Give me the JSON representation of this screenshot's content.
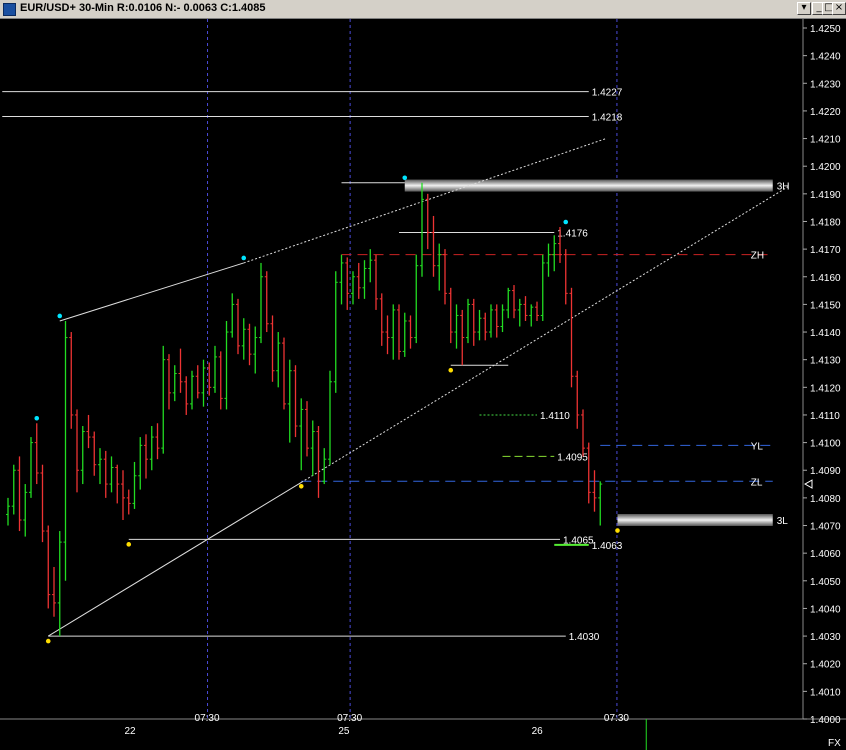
{
  "window": {
    "title": "EUR/USD+ 30-Min R:0.0106 N:- 0.0063 C:1.4085",
    "buttons": {
      "menu": "▾",
      "minimize": "_",
      "maximize": "□",
      "close": "×"
    }
  },
  "colors": {
    "background": "#000000",
    "up_bar": "#22dd22",
    "down_bar": "#ee3333",
    "axis_text": "#dddddd",
    "session_line": "#4a4ad8",
    "zone_bar": "#cccccc"
  },
  "chart_data": {
    "type": "ohlc",
    "symbol": "EUR/USD+",
    "interval": "30-Min",
    "y_axis": {
      "min": 1.4,
      "max": 1.425,
      "step": 0.001,
      "decimals": 4,
      "side": "right"
    },
    "x_axis": {
      "day_labels": [
        "22",
        "25",
        "26"
      ],
      "session_labels": [
        "07:30",
        "07:30",
        "07:30"
      ]
    },
    "footer_label": "FX",
    "bars": [
      [
        1.4074,
        1.408,
        1.407,
        1.4077
      ],
      [
        1.4077,
        1.4092,
        1.4074,
        1.409
      ],
      [
        1.409,
        1.4095,
        1.4068,
        1.4072
      ],
      [
        1.4072,
        1.4085,
        1.4066,
        1.4082
      ],
      [
        1.4082,
        1.4102,
        1.408,
        1.41
      ],
      [
        1.41,
        1.4107,
        1.4085,
        1.4089
      ],
      [
        1.4089,
        1.4092,
        1.4064,
        1.4068
      ],
      [
        1.4068,
        1.407,
        1.404,
        1.4045
      ],
      [
        1.4045,
        1.4055,
        1.4037,
        1.4042
      ],
      [
        1.4042,
        1.4068,
        1.403,
        1.4064
      ],
      [
        1.4064,
        1.4144,
        1.405,
        1.4138
      ],
      [
        1.4138,
        1.414,
        1.4105,
        1.411
      ],
      [
        1.411,
        1.4112,
        1.4082,
        1.409
      ],
      [
        1.409,
        1.4106,
        1.4085,
        1.4104
      ],
      [
        1.4104,
        1.411,
        1.4098,
        1.4102
      ],
      [
        1.4102,
        1.4104,
        1.4088,
        1.4092
      ],
      [
        1.4092,
        1.4098,
        1.4085,
        1.4094
      ],
      [
        1.4094,
        1.4097,
        1.408,
        1.4085
      ],
      [
        1.4085,
        1.4095,
        1.4082,
        1.4091
      ],
      [
        1.4091,
        1.4092,
        1.4078,
        1.4085
      ],
      [
        1.4085,
        1.409,
        1.4072,
        1.408
      ],
      [
        1.408,
        1.4083,
        1.4074,
        1.4078
      ],
      [
        1.4078,
        1.4093,
        1.4076,
        1.4088
      ],
      [
        1.4088,
        1.4102,
        1.4083,
        1.4099
      ],
      [
        1.4099,
        1.4103,
        1.4087,
        1.4094
      ],
      [
        1.4094,
        1.4106,
        1.409,
        1.4102
      ],
      [
        1.4102,
        1.4107,
        1.4094,
        1.4098
      ],
      [
        1.4098,
        1.4135,
        1.4096,
        1.413
      ],
      [
        1.413,
        1.4132,
        1.4112,
        1.4118
      ],
      [
        1.4118,
        1.4128,
        1.4115,
        1.4125
      ],
      [
        1.4125,
        1.4134,
        1.4118,
        1.4122
      ],
      [
        1.4122,
        1.4124,
        1.411,
        1.4114
      ],
      [
        1.4114,
        1.4126,
        1.4112,
        1.4124
      ],
      [
        1.4124,
        1.4128,
        1.4116,
        1.4118
      ],
      [
        1.4118,
        1.413,
        1.4113,
        1.4127
      ],
      [
        1.4127,
        1.4129,
        1.4117,
        1.412
      ],
      [
        1.412,
        1.4135,
        1.4118,
        1.4131
      ],
      [
        1.4131,
        1.4133,
        1.4112,
        1.4116
      ],
      [
        1.4116,
        1.4144,
        1.4112,
        1.414
      ],
      [
        1.414,
        1.4154,
        1.4138,
        1.415
      ],
      [
        1.415,
        1.4152,
        1.4132,
        1.4135
      ],
      [
        1.4135,
        1.4145,
        1.413,
        1.4141
      ],
      [
        1.4141,
        1.4143,
        1.4128,
        1.4132
      ],
      [
        1.4132,
        1.4142,
        1.4125,
        1.4138
      ],
      [
        1.4138,
        1.4165,
        1.4136,
        1.416
      ],
      [
        1.416,
        1.4162,
        1.414,
        1.4143
      ],
      [
        1.4143,
        1.4146,
        1.4122,
        1.4126
      ],
      [
        1.4126,
        1.414,
        1.412,
        1.4136
      ],
      [
        1.4136,
        1.4138,
        1.4112,
        1.4114
      ],
      [
        1.4114,
        1.413,
        1.41,
        1.4126
      ],
      [
        1.4126,
        1.4128,
        1.4102,
        1.4106
      ],
      [
        1.4106,
        1.4116,
        1.409,
        1.4112
      ],
      [
        1.4112,
        1.4115,
        1.4095,
        1.4098
      ],
      [
        1.4098,
        1.4108,
        1.4088,
        1.4104
      ],
      [
        1.4104,
        1.4106,
        1.408,
        1.4086
      ],
      [
        1.4086,
        1.4098,
        1.4085,
        1.4094
      ],
      [
        1.4094,
        1.4126,
        1.4092,
        1.4122
      ],
      [
        1.4122,
        1.4162,
        1.4118,
        1.4158
      ],
      [
        1.4158,
        1.4168,
        1.415,
        1.4165
      ],
      [
        1.4165,
        1.4167,
        1.4148,
        1.4154
      ],
      [
        1.4154,
        1.4162,
        1.415,
        1.416
      ],
      [
        1.416,
        1.4165,
        1.4152,
        1.4156
      ],
      [
        1.4156,
        1.4166,
        1.4152,
        1.4163
      ],
      [
        1.4163,
        1.417,
        1.4158,
        1.4166
      ],
      [
        1.4166,
        1.4168,
        1.4148,
        1.4152
      ],
      [
        1.4152,
        1.4154,
        1.4135,
        1.414
      ],
      [
        1.414,
        1.4146,
        1.4132,
        1.4138
      ],
      [
        1.4138,
        1.415,
        1.413,
        1.4148
      ],
      [
        1.4148,
        1.415,
        1.413,
        1.4133
      ],
      [
        1.4133,
        1.4147,
        1.4131,
        1.4144
      ],
      [
        1.4144,
        1.4146,
        1.4134,
        1.4138
      ],
      [
        1.4138,
        1.4168,
        1.4136,
        1.4164
      ],
      [
        1.4164,
        1.4194,
        1.416,
        1.4188
      ],
      [
        1.4188,
        1.419,
        1.417,
        1.4176
      ],
      [
        1.4176,
        1.4182,
        1.416,
        1.4164
      ],
      [
        1.4164,
        1.4172,
        1.4155,
        1.4168
      ],
      [
        1.4168,
        1.417,
        1.415,
        1.4154
      ],
      [
        1.4154,
        1.4156,
        1.4136,
        1.414
      ],
      [
        1.414,
        1.415,
        1.4134,
        1.4146
      ],
      [
        1.4146,
        1.4148,
        1.4128,
        1.4138
      ],
      [
        1.4138,
        1.4152,
        1.4136,
        1.415
      ],
      [
        1.415,
        1.4152,
        1.4135,
        1.414
      ],
      [
        1.414,
        1.4148,
        1.4137,
        1.4145
      ],
      [
        1.4145,
        1.4147,
        1.4137,
        1.414
      ],
      [
        1.414,
        1.415,
        1.4138,
        1.4148
      ],
      [
        1.4148,
        1.415,
        1.4138,
        1.4142
      ],
      [
        1.4142,
        1.415,
        1.414,
        1.4148
      ],
      [
        1.4148,
        1.4156,
        1.4145,
        1.4155
      ],
      [
        1.4155,
        1.4157,
        1.4145,
        1.4148
      ],
      [
        1.4148,
        1.4152,
        1.4142,
        1.415
      ],
      [
        1.415,
        1.4153,
        1.4144,
        1.4146
      ],
      [
        1.4146,
        1.415,
        1.4142,
        1.4149
      ],
      [
        1.4149,
        1.4151,
        1.4144,
        1.4146
      ],
      [
        1.4146,
        1.4168,
        1.4144,
        1.4165
      ],
      [
        1.4165,
        1.4172,
        1.416,
        1.4168
      ],
      [
        1.4168,
        1.4175,
        1.4162,
        1.4172
      ],
      [
        1.4172,
        1.4178,
        1.4165,
        1.4168
      ],
      [
        1.4168,
        1.417,
        1.415,
        1.4154
      ],
      [
        1.4154,
        1.4156,
        1.412,
        1.4124
      ],
      [
        1.4124,
        1.4126,
        1.4105,
        1.411
      ],
      [
        1.411,
        1.4112,
        1.4095,
        1.4098
      ],
      [
        1.4098,
        1.41,
        1.4078,
        1.4082
      ],
      [
        1.4082,
        1.409,
        1.4075,
        1.408
      ],
      [
        1.408,
        1.4086,
        1.407,
        1.4085
      ]
    ],
    "lines": [
      {
        "name": "1.4227",
        "kind": "hline",
        "price": 1.4227,
        "i0": -1.0,
        "i1": 101.0,
        "color": "#dddddd",
        "dash": "",
        "label": "1.4227"
      },
      {
        "name": "1.4218",
        "kind": "hline",
        "price": 1.4218,
        "i0": -1.0,
        "i1": 101.0,
        "color": "#dddddd",
        "dash": "",
        "label": "1.4218"
      },
      {
        "name": "1.4176",
        "kind": "hline",
        "price": 1.4176,
        "i0": 68.0,
        "i1": 95.0,
        "color": "#dddddd",
        "dash": "",
        "label": "1.4176"
      },
      {
        "name": "1.4128",
        "kind": "hline",
        "price": 1.4128,
        "i0": 77.0,
        "i1": 87.0,
        "color": "#dddddd",
        "dash": "",
        "label": ""
      },
      {
        "name": "1.4110",
        "kind": "hline",
        "price": 1.411,
        "i0": 82.0,
        "i1": 92.0,
        "color": "#44dd44",
        "dash": "2,2",
        "label": "1.4110"
      },
      {
        "name": "1.4095",
        "kind": "hline",
        "price": 1.4095,
        "i0": 86.0,
        "i1": 95.0,
        "color": "#88dd33",
        "dash": "8,4",
        "label": "1.4095"
      },
      {
        "name": "1.4065",
        "kind": "hline",
        "price": 1.4065,
        "i0": 21.0,
        "i1": 96.0,
        "color": "#dddddd",
        "dash": "",
        "label": "1.4065"
      },
      {
        "name": "1.4063",
        "kind": "hline",
        "price": 1.4063,
        "i0": 95.0,
        "i1": 101.0,
        "color": "#55ee33",
        "dash": "",
        "width": 2,
        "label": "1.4063"
      },
      {
        "name": "1.4030",
        "kind": "hline",
        "price": 1.403,
        "i0": 7.0,
        "i1": 97.0,
        "color": "#dddddd",
        "dash": "",
        "label": "1.4030"
      },
      {
        "name": "ZH",
        "kind": "hline",
        "price": 1.4168,
        "i0": 58.0,
        "i1": 133.0,
        "color": "#cc2222",
        "dash": "10,6",
        "label": "ZH"
      },
      {
        "name": "YL",
        "kind": "hline",
        "price": 1.4099,
        "i0": 103.0,
        "i1": 133.0,
        "color": "#3366dd",
        "dash": "10,6",
        "label": "YL"
      },
      {
        "name": "ZL",
        "kind": "hline",
        "price": 1.4086,
        "i0": 51.0,
        "i1": 133.0,
        "color": "#3366dd",
        "dash": "10,6",
        "label": "ZL"
      },
      {
        "name": "3H",
        "kind": "zone",
        "price": 1.4193,
        "i0": 69.0,
        "i1": 133.0,
        "color": "#cccccc",
        "label": "3H"
      },
      {
        "name": "3L",
        "kind": "zone",
        "price": 1.4072,
        "i0": 106.0,
        "i1": 133.0,
        "color": "#cccccc",
        "label": "3L"
      },
      {
        "name": "3H-connector",
        "kind": "hline",
        "price": 1.4194,
        "i0": 58.0,
        "i1": 69.0,
        "color": "#dddddd",
        "dash": "",
        "label": ""
      },
      {
        "name": "lower-trend",
        "kind": "trend",
        "p0": [
          7,
          1.403
        ],
        "p1": [
          136,
          1.4193
        ],
        "color": "#dddddd",
        "dash": "2,2",
        "solid_until": 51
      },
      {
        "name": "upper-trend",
        "kind": "trend",
        "p0": [
          9,
          1.4144
        ],
        "p1": [
          41,
          1.4165
        ],
        "color": "#dddddd",
        "dash": "",
        "label": ""
      },
      {
        "name": "upper-trend-ext",
        "kind": "trend",
        "p0": [
          41,
          1.4165
        ],
        "p1": [
          104,
          1.421
        ],
        "color": "#dddddd",
        "dash": "2,2",
        "label": ""
      }
    ],
    "markers": [
      {
        "i": 5,
        "price": 1.4107,
        "color": "#00e5ff",
        "pos": "above"
      },
      {
        "i": 9,
        "price": 1.4144,
        "color": "#00e5ff",
        "pos": "above"
      },
      {
        "i": 41,
        "price": 1.4165,
        "color": "#00e5ff",
        "pos": "above"
      },
      {
        "i": 69,
        "price": 1.4194,
        "color": "#00e5ff",
        "pos": "above"
      },
      {
        "i": 97,
        "price": 1.4178,
        "color": "#00e5ff",
        "pos": "above"
      },
      {
        "i": 7,
        "price": 1.403,
        "color": "#ffdd00",
        "pos": "below"
      },
      {
        "i": 21,
        "price": 1.4065,
        "color": "#ffdd00",
        "pos": "below"
      },
      {
        "i": 51,
        "price": 1.4086,
        "color": "#ffdd00",
        "pos": "below"
      },
      {
        "i": 77,
        "price": 1.4128,
        "color": "#ffdd00",
        "pos": "below"
      },
      {
        "i": 106,
        "price": 1.407,
        "color": "#ffdd00",
        "pos": "below"
      }
    ],
    "session_dividers": [
      34.7,
      59.5,
      105.9
    ],
    "day_label_positions": [
      21.3,
      58.5,
      92.1
    ],
    "footer_tick_index": 111.0
  }
}
